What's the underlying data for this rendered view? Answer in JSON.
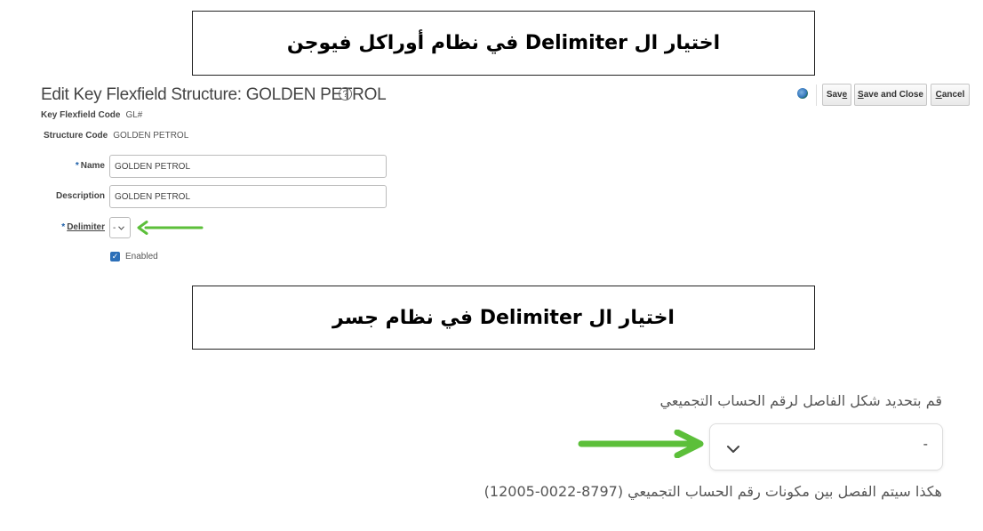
{
  "banner_top": "اختيار ال Delimiter في نظام أوراكل فيوجن",
  "banner_bottom": "اختيار ال Delimiter في نظام جسر",
  "oracle": {
    "title": "Edit Key Flexfield Structure: GOLDEN PETROL",
    "help_icon": "?",
    "key_flexfield_code_label": "Key Flexfield Code",
    "key_flexfield_code_value": "GL#",
    "structure_code_label": "Structure Code",
    "structure_code_value": "GOLDEN PETROL",
    "required_mark": "*",
    "name_label": "Name",
    "name_value": "GOLDEN PETROL",
    "description_label": "Description",
    "description_value": "GOLDEN PETROL",
    "delimiter_label": "Delimiter",
    "delimiter_value": "-",
    "enabled_label": "Enabled",
    "enabled_checked": true,
    "buttons": {
      "save_prefix": "Sav",
      "save_rest": "e",
      "save_close_first": "S",
      "save_close_rest": "ave and Close",
      "cancel_first": "C",
      "cancel_rest": "ancel"
    }
  },
  "jisr": {
    "prompt": "قم بتحديد شكل الفاصل لرقم الحساب التجميعي",
    "select_value": "-",
    "note": "هكذا سيتم الفصل بين مكونات رقم الحساب التجميعي (8797-0022-12005)"
  },
  "colors": {
    "arrow_green": "#5cbf3a",
    "required_blue": "#1c5ea8",
    "checkbox_blue": "#2c6fb8"
  },
  "icons": [
    "help-icon",
    "globe-icon",
    "chevron-down-icon",
    "check-icon",
    "arrow-left-icon",
    "arrow-right-icon"
  ]
}
